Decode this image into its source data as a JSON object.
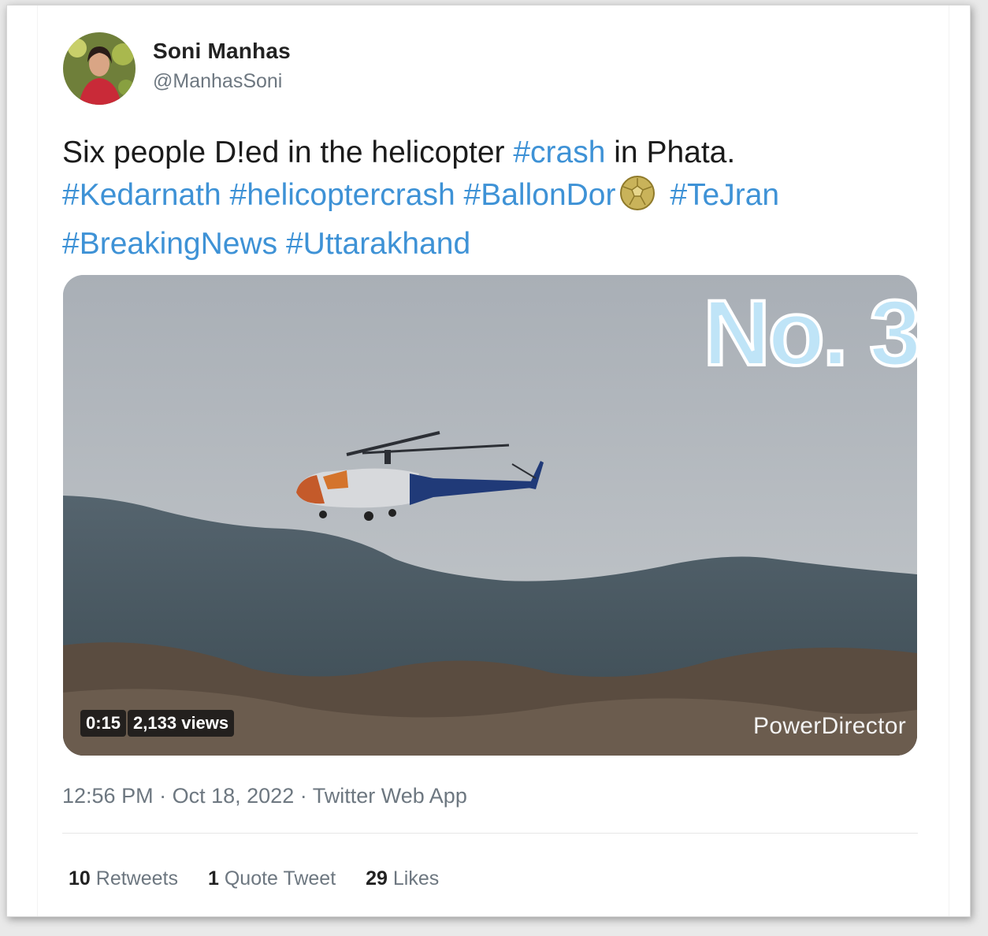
{
  "user": {
    "name": "Soni Manhas",
    "handle": "@ManhasSoni"
  },
  "tweet": {
    "text_parts": {
      "t1": "Six people D!ed in the helicopter ",
      "h_crash": "#crash",
      "t2": " in Phata.",
      "h_kedarnath": "#Kedarnath",
      "h_helicoptercrash": "#helicoptercrash",
      "h_ballondor": "#BallonDor",
      "h_tejran": "#TeJran",
      "h_breakingnews": "#BreakingNews",
      "h_uttarakhand": "#Uttarakhand"
    },
    "hashtag_color": "#3e92d6"
  },
  "media": {
    "overlay_text": "No. 3",
    "duration": "0:15",
    "views": "2,133 views",
    "watermark": "PowerDirector"
  },
  "meta": {
    "time": "12:56 PM",
    "date": "Oct 18, 2022",
    "source": "Twitter Web App"
  },
  "stats": {
    "retweets_count": "10",
    "retweets_label": "Retweets",
    "quotes_count": "1",
    "quotes_label": "Quote Tweet",
    "likes_count": "29",
    "likes_label": "Likes"
  }
}
